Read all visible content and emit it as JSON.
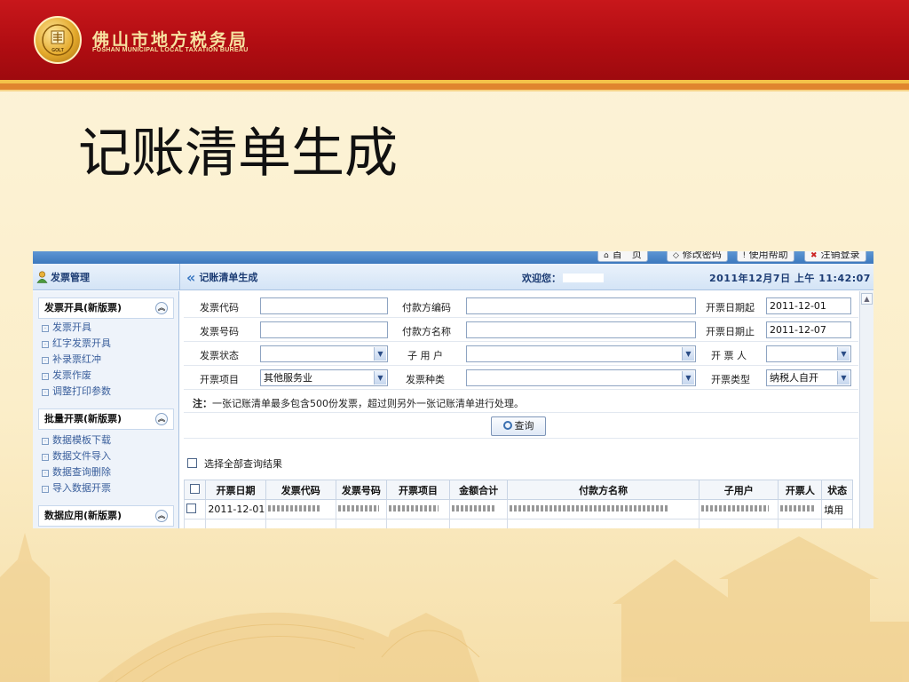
{
  "slide": {
    "org_name_cn": "佛山市地方税务局",
    "org_name_en": "FOSHAN MUNICIPAL LOCAL TAXATION BUREAU",
    "logo_text": "GOLT",
    "title": "记账清单生成"
  },
  "app": {
    "top_buttons": [
      {
        "label": "首　页",
        "icon": "home-icon"
      },
      {
        "label": "修改密码",
        "icon": "key-icon"
      },
      {
        "label": "使用帮助",
        "icon": "help-icon"
      },
      {
        "label": "注销登录",
        "icon": "logout-icon"
      }
    ],
    "header": {
      "module": "发票管理",
      "page": "记账清单生成",
      "welcome": "欢迎您：",
      "datetime": "2011年12月7日 上午 11:42:07"
    },
    "sidebar": {
      "sections": [
        {
          "title": "发票开具(新版票)",
          "items": [
            "发票开具",
            "红字发票开具",
            "补录票红冲",
            "发票作废",
            "调整打印参数"
          ]
        },
        {
          "title": "批量开票(新版票)",
          "items": [
            "数据模板下载",
            "数据文件导入",
            "数据查询删除",
            "导入数据开票"
          ]
        },
        {
          "title": "数据应用(新版票)",
          "items": []
        }
      ]
    },
    "form": {
      "labels": {
        "invoice_code": "发票代码",
        "payer_code": "付款方编码",
        "date_from": "开票日期起",
        "invoice_no": "发票号码",
        "payer_name": "付款方名称",
        "date_to": "开票日期止",
        "invoice_status": "发票状态",
        "sub_user": "子 用 户",
        "issuer": "开 票 人",
        "item": "开票项目",
        "invoice_kind": "发票种类",
        "invoice_type": "开票类型"
      },
      "values": {
        "invoice_code": "",
        "payer_code": "",
        "date_from": "2011-12-01",
        "invoice_no": "",
        "payer_name": "",
        "date_to": "2011-12-07",
        "invoice_status": "",
        "sub_user": "",
        "issuer": "",
        "item": "其他服务业",
        "invoice_kind": "",
        "invoice_type": "纳税人自开"
      },
      "note_prefix": "注：",
      "note_text": "一张记账清单最多包含500份发票，超过则另外一张记账清单进行处理。",
      "query_button": "查询"
    },
    "results": {
      "select_all": "选择全部查询结果",
      "columns": [
        "开票日期",
        "发票代码",
        "发票号码",
        "开票项目",
        "金额合计",
        "付款方名称",
        "子用户",
        "开票人",
        "状态"
      ],
      "rows": [
        {
          "date": "2011-12-01",
          "status": "填用"
        }
      ]
    }
  }
}
